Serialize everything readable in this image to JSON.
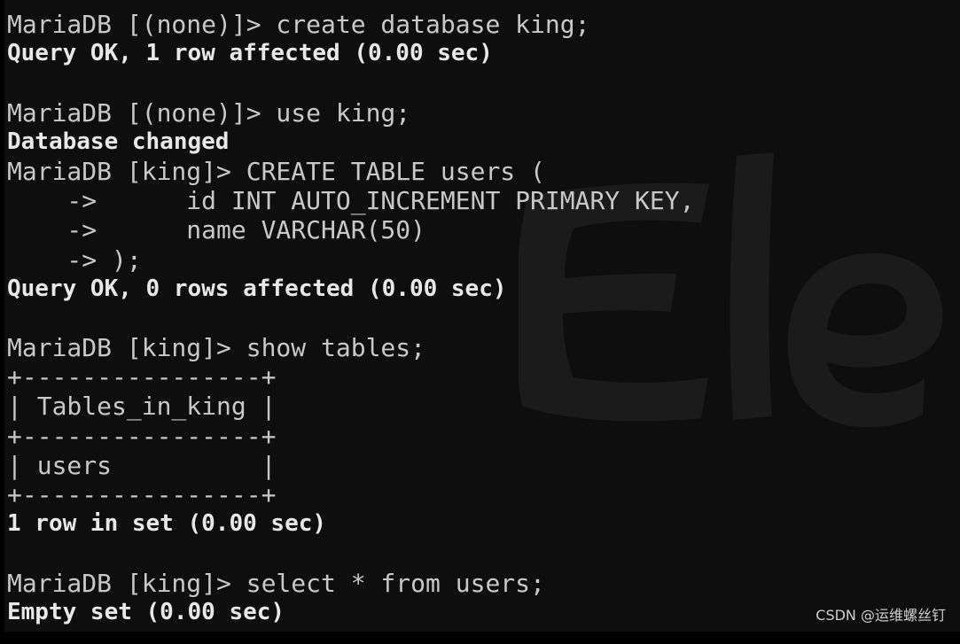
{
  "terminal": {
    "app_watermark_text": "Electerm",
    "background_color": "#0e0e0e",
    "prompt_color": "#c8c8c8",
    "output_color": "#e8e8e8",
    "lines": [
      {
        "text": "MariaDB [(none)]> create database king;",
        "style": "prompt"
      },
      {
        "text": "Query OK, 1 row affected (0.00 sec)",
        "style": "output"
      },
      {
        "text": "",
        "style": "blank"
      },
      {
        "text": "MariaDB [(none)]> use king;",
        "style": "prompt"
      },
      {
        "text": "Database changed",
        "style": "output"
      },
      {
        "text": "MariaDB [king]> CREATE TABLE users (",
        "style": "prompt"
      },
      {
        "text": "    ->      id INT AUTO_INCREMENT PRIMARY KEY,",
        "style": "prompt"
      },
      {
        "text": "    ->      name VARCHAR(50)",
        "style": "prompt"
      },
      {
        "text": "    -> );",
        "style": "prompt"
      },
      {
        "text": "Query OK, 0 rows affected (0.00 sec)",
        "style": "output"
      },
      {
        "text": "",
        "style": "blank"
      },
      {
        "text": "MariaDB [king]> show tables;",
        "style": "prompt"
      },
      {
        "text": "+----------------+",
        "style": "prompt"
      },
      {
        "text": "| Tables_in_king |",
        "style": "prompt"
      },
      {
        "text": "+----------------+",
        "style": "prompt"
      },
      {
        "text": "| users          |",
        "style": "prompt"
      },
      {
        "text": "+----------------+",
        "style": "prompt"
      },
      {
        "text": "1 row in set (0.00 sec)",
        "style": "output"
      },
      {
        "text": "",
        "style": "blank"
      },
      {
        "text": "MariaDB [king]> select * from users;",
        "style": "prompt"
      },
      {
        "text": "Empty set (0.00 sec)",
        "style": "output"
      }
    ]
  },
  "credit": {
    "text": "CSDN @运维螺丝钉"
  }
}
